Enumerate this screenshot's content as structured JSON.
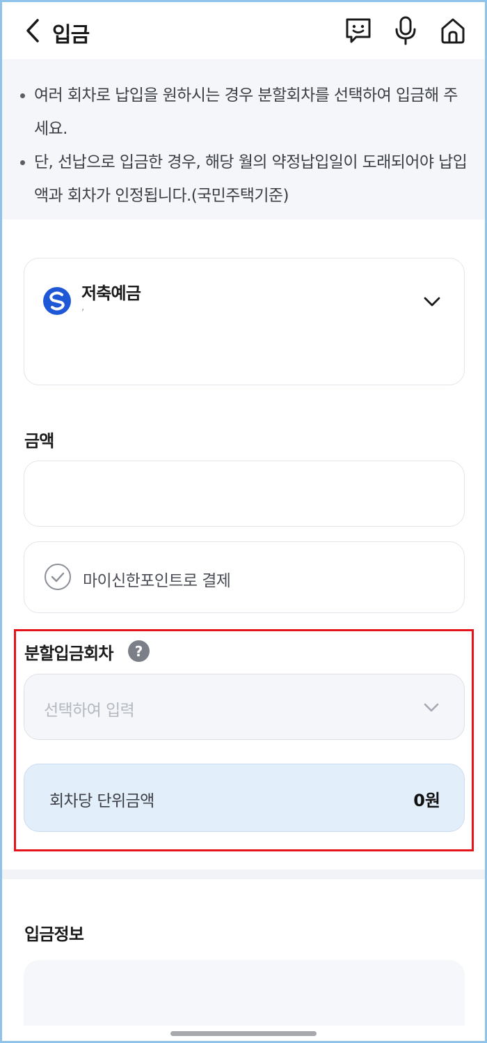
{
  "header": {
    "title": "입금",
    "icons": [
      "back-icon",
      "chatbot-icon",
      "mic-icon",
      "home-icon"
    ]
  },
  "notice": {
    "items": [
      "여러 회차로 납입을 원하시는 경우 분할회차를 선택하여 입금해 주세요.",
      "단, 선납으로 입금한 경우, 해당 월의 약정납입일이 도래되어야 납입액과 회차가 인정됩니다.(국민주택기준)"
    ]
  },
  "account": {
    "name": "저축예금",
    "number": ","
  },
  "amount": {
    "label": "금액",
    "value": ""
  },
  "point": {
    "label": "마이신한포인트로 결제"
  },
  "installment": {
    "label": "분할입금회차",
    "help": "?",
    "placeholder": "선택하여 입력",
    "unit_label": "회차당 단위금액",
    "unit_value": "0원"
  },
  "info": {
    "label": "입금정보"
  },
  "colors": {
    "highlight": "#e5141b",
    "accent_blue": "#1f58d6",
    "unit_bg": "#e3eefb"
  }
}
